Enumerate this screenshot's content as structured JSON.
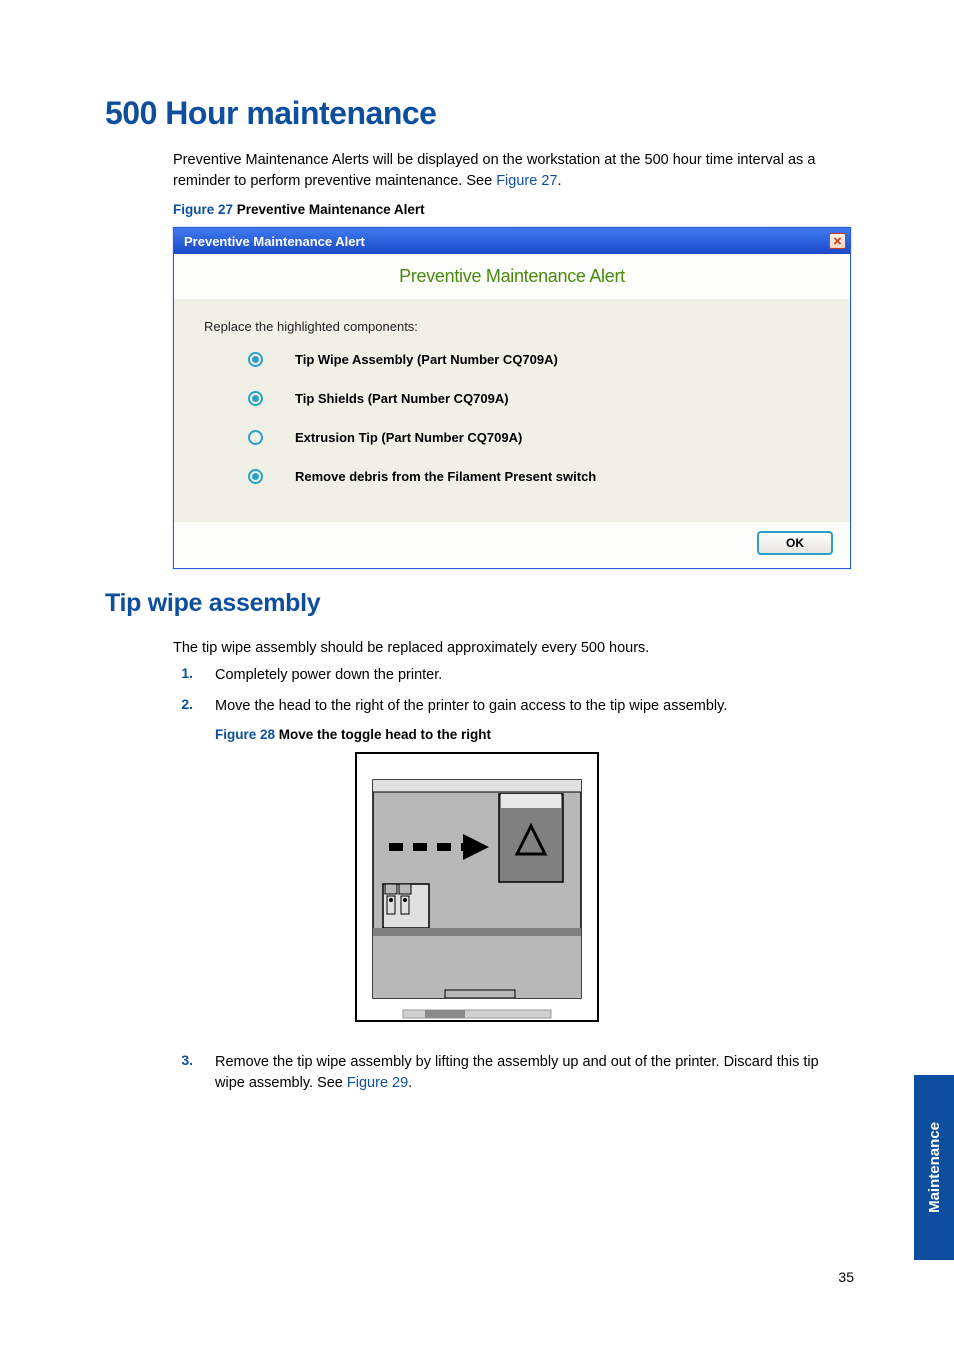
{
  "sectionTitle": "500 Hour maintenance",
  "intro": {
    "text_before_link": "Preventive Maintenance Alerts will be displayed on the workstation at the 500 hour time interval as a reminder to perform preventive maintenance. See ",
    "link": "Figure 27",
    "text_after_link": "."
  },
  "figure27": {
    "lead": "Figure 27",
    "title": " Preventive Maintenance Alert"
  },
  "alert": {
    "titlebar": "Preventive Maintenance Alert",
    "heading": "Preventive Maintenance Alert",
    "instruction": "Replace the highlighted components:",
    "items": [
      {
        "selected": true,
        "label": "Tip Wipe Assembly  (Part Number CQ709A)"
      },
      {
        "selected": true,
        "label": "Tip Shields  (Part Number CQ709A)"
      },
      {
        "selected": false,
        "label": "Extrusion Tip  (Part Number CQ709A)"
      },
      {
        "selected": true,
        "label": "Remove debris from the Filament Present switch"
      }
    ],
    "ok": "OK"
  },
  "h2": "Tip wipe assembly",
  "subIntro": "The tip wipe assembly should be replaced approximately every 500 hours.",
  "steps": {
    "s1": "Completely power down the printer.",
    "s2": "Move the head to the right of the printer to gain access to the tip wipe assembly.",
    "s3_before": "Remove the tip wipe assembly by lifting the assembly up and out of the printer. Discard this tip wipe assembly. See ",
    "s3_link": "Figure 29",
    "s3_after": "."
  },
  "figure28": {
    "lead": "Figure 28",
    "title": " Move the toggle head to the right"
  },
  "sideTab": "Maintenance",
  "pageNum": "35",
  "nums": {
    "n1": "1.",
    "n2": "2.",
    "n3": "3."
  }
}
